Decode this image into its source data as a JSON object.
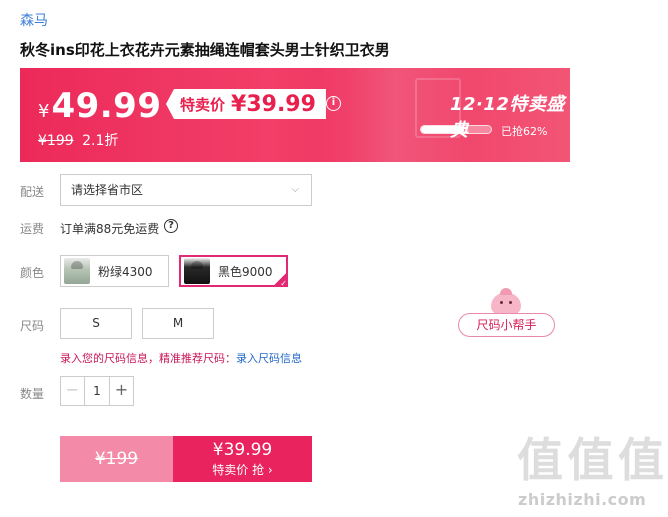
{
  "brand": "森马",
  "title": "秋冬ins印花上衣花卉元素抽绳连帽套头男士针织卫衣男",
  "banner": {
    "yen": "¥",
    "price": "49.99",
    "tag_label": "特卖价",
    "tag_price": "¥39.99",
    "info_icon": "info-icon",
    "original_price": "¥199",
    "discount": "2.1折",
    "event": "12·12特卖盛典",
    "progress_fraction": 0.62,
    "progress_label": "已抢62%",
    "accent": "#ec2a5a"
  },
  "delivery": {
    "label": "配送",
    "placeholder": "请选择省市区",
    "chevron_icon": "chevron-down-icon"
  },
  "shipping": {
    "label": "运费",
    "text": "订单满88元免运费",
    "help_icon": "question-icon"
  },
  "color": {
    "label": "颜色",
    "options": [
      {
        "label": "粉绿4300",
        "selected": false
      },
      {
        "label": "黑色9000",
        "selected": true
      }
    ],
    "selected_color": "#e22a74"
  },
  "size": {
    "label": "尺码",
    "options": [
      "S",
      "M"
    ],
    "helper": "尺码小帮手",
    "tip": "录入您的尺码信息，精准推荐尺码：",
    "tip_link": "录入尺码信息"
  },
  "quantity": {
    "label": "数量",
    "minus": "−",
    "value": "1",
    "plus": "+"
  },
  "buy": {
    "original": "¥199",
    "price": "¥39.99",
    "cta": "特卖价 抢 ›"
  },
  "watermark": {
    "chars": [
      "值",
      "值",
      "值"
    ],
    "text": "zhizhizhi.com"
  }
}
